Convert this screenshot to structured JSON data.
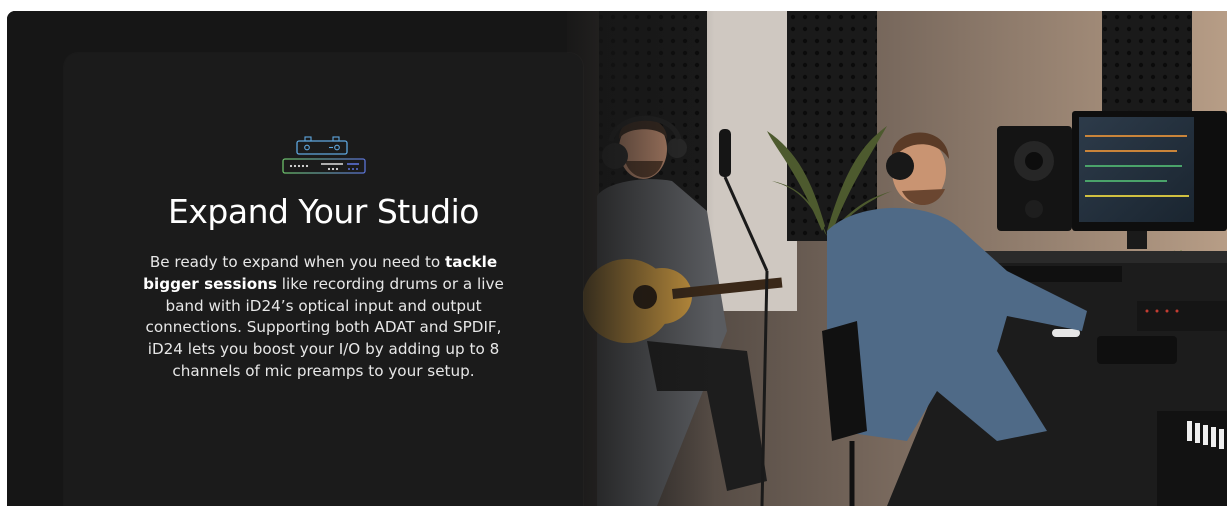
{
  "hero": {
    "title": "Expand Your Studio",
    "body": {
      "part1": "Be ready to expand when you need to ",
      "bold": "tackle bigger sessions",
      "part2": " like recording drums or a live band with iD24’s optical input and output connections. Supporting both ADAT and SPDIF, iD24 lets you boost your I/O by adding up to 8 channels of mic preamps to your setup."
    },
    "icon": "audio-interface-stack-icon"
  },
  "colors": {
    "page_bg": "#ffffff",
    "section_bg": "#161616",
    "card_bg": "#1b1b1b",
    "title_text": "#ffffff",
    "body_text": "#e7e7e7",
    "icon_top": "#5fa8e0",
    "icon_bottom_left": "#6cc06a",
    "icon_bottom_right": "#5b73d6"
  }
}
